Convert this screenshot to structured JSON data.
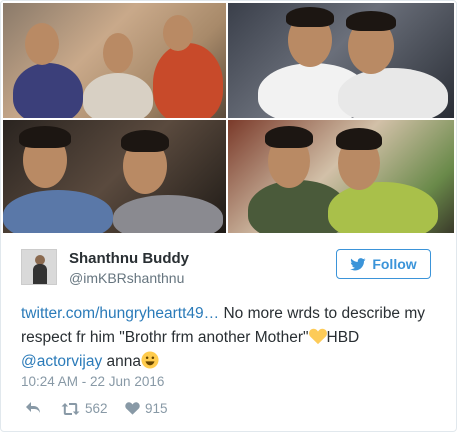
{
  "tweet": {
    "author_name": "Shanthnu Buddy",
    "author_handle": "@imKBRshanthnu",
    "follow_label": "Follow",
    "text_link": "twitter.com/hungryheartt49…",
    "text_part1": " No more wrds to describe my respect fr him \"Brothr frm another Mother\"",
    "text_part2": "HBD ",
    "mention": "@actorvijay",
    "text_part3": " anna",
    "timestamp": "10:24 AM - 22 Jun 2016",
    "retweets": "562",
    "likes": "915"
  },
  "icons": {
    "reply": "reply-icon",
    "retweet": "retweet-icon",
    "like": "heart-icon",
    "follow": "twitter-bird-icon",
    "emoji_heart": "yellow-heart-emoji",
    "emoji_smile": "smiley-emoji"
  },
  "colors": {
    "link": "#2b7bb9",
    "follow": "#3b94d9",
    "muted": "#8899a6"
  }
}
